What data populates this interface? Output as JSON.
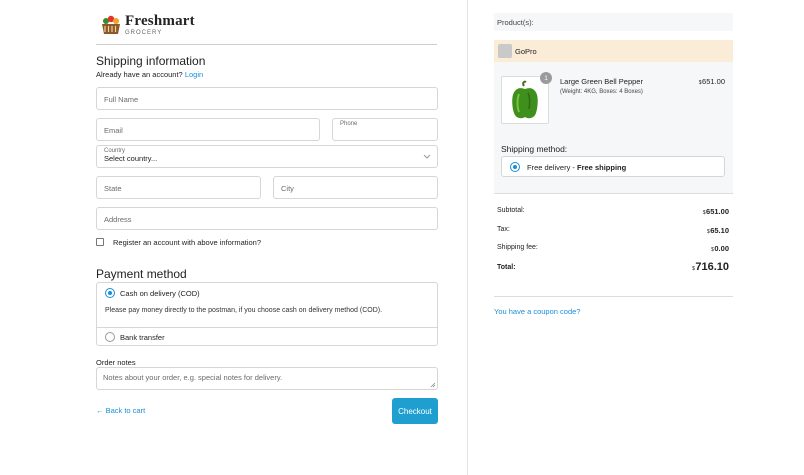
{
  "brand": {
    "name": "Freshmart",
    "sub": "GROCERY"
  },
  "shipping": {
    "title": "Shipping information",
    "account_prompt": "Already have an account?",
    "login_link": "Login",
    "full_name_placeholder": "Full Name",
    "email_placeholder": "Email",
    "phone_label": "Phone",
    "country_label": "Country",
    "country_value": "Select country...",
    "state_placeholder": "State",
    "city_placeholder": "City",
    "address_placeholder": "Address",
    "register_label": "Register an account with above information?"
  },
  "payment": {
    "title": "Payment method",
    "cod_label": "Cash on delivery (COD)",
    "cod_description": "Please pay money directly to the postman, if you choose cash on delivery method (COD).",
    "bank_label": "Bank transfer",
    "selected": "cod"
  },
  "notes": {
    "label": "Order notes",
    "placeholder": "Notes about your order, e.g. special notes for delivery."
  },
  "actions": {
    "back": "← Back to cart",
    "checkout": "Checkout"
  },
  "order": {
    "products_header": "Product(s):",
    "vendor": "GoPro",
    "item": {
      "quantity": "1",
      "name": "Large Green Bell Pepper",
      "meta": "(Weight: 4KG, Boxes: 4 Boxes)",
      "currency": "$",
      "price": "651.00"
    },
    "shipping_method_title": "Shipping method:",
    "shipping_option": "Free delivery - ",
    "shipping_option_bold": "Free shipping",
    "currency": "$",
    "subtotal_label": "Subtotal:",
    "subtotal": "651.00",
    "tax_label": "Tax:",
    "tax": "65.10",
    "shipping_fee_label": "Shipping fee:",
    "shipping_fee": "0.00",
    "total_label": "Total:",
    "total": "716.10",
    "coupon_link": "You have a coupon code?"
  },
  "colors": {
    "accent": "#1a8fd8",
    "checkout_bg": "#1e9fd0",
    "vendor_bg": "#fbecd7",
    "panel_bg": "#f6f7f8"
  }
}
